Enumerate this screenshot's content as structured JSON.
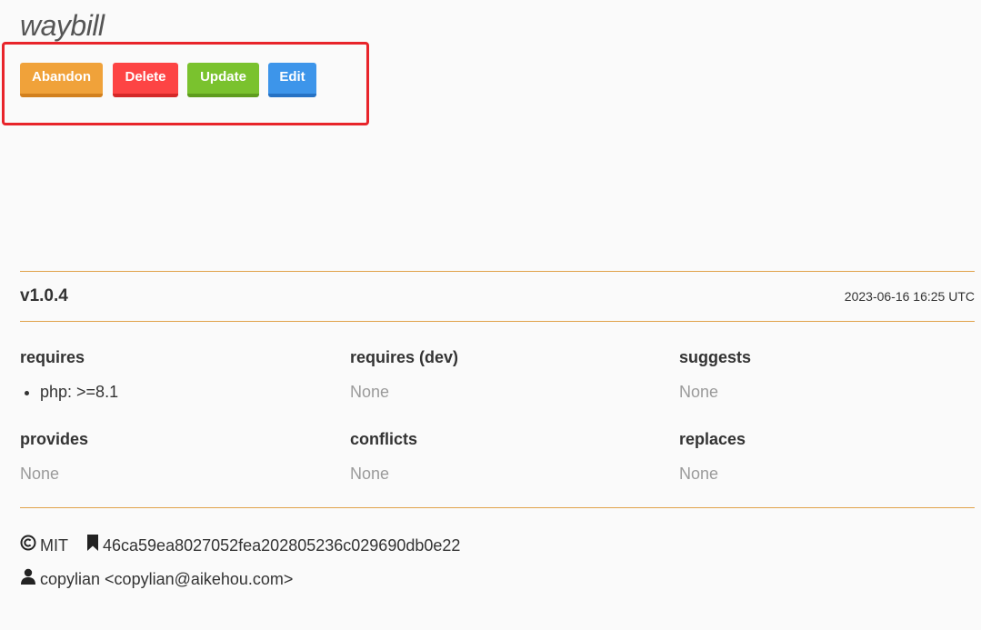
{
  "package": {
    "name": "waybill"
  },
  "actions": {
    "abandon_label": "Abandon",
    "delete_label": "Delete",
    "update_label": "Update",
    "edit_label": "Edit"
  },
  "release": {
    "version": "v1.0.4",
    "date": "2023-06-16 16:25 UTC"
  },
  "dependencies": {
    "requires": {
      "heading": "requires",
      "items": [
        "php: >=8.1"
      ]
    },
    "requires_dev": {
      "heading": "requires (dev)",
      "empty": "None"
    },
    "suggests": {
      "heading": "suggests",
      "empty": "None"
    },
    "provides": {
      "heading": "provides",
      "empty": "None"
    },
    "conflicts": {
      "heading": "conflicts",
      "empty": "None"
    },
    "replaces": {
      "heading": "replaces",
      "empty": "None"
    }
  },
  "meta": {
    "license": "MIT",
    "license_icon": "copyright-icon",
    "reference": "46ca59ea8027052fea202805236c029690db0e22",
    "reference_icon": "bookmark-icon",
    "author": "copylian <copylian@aikehou.com>",
    "author_icon": "user-icon"
  },
  "colors": {
    "abandon": "#f0a23a",
    "delete": "#fd4444",
    "update": "#7ac22e",
    "edit": "#3d95ea",
    "highlight": "#e8242a",
    "divider": "#e0a24a"
  }
}
